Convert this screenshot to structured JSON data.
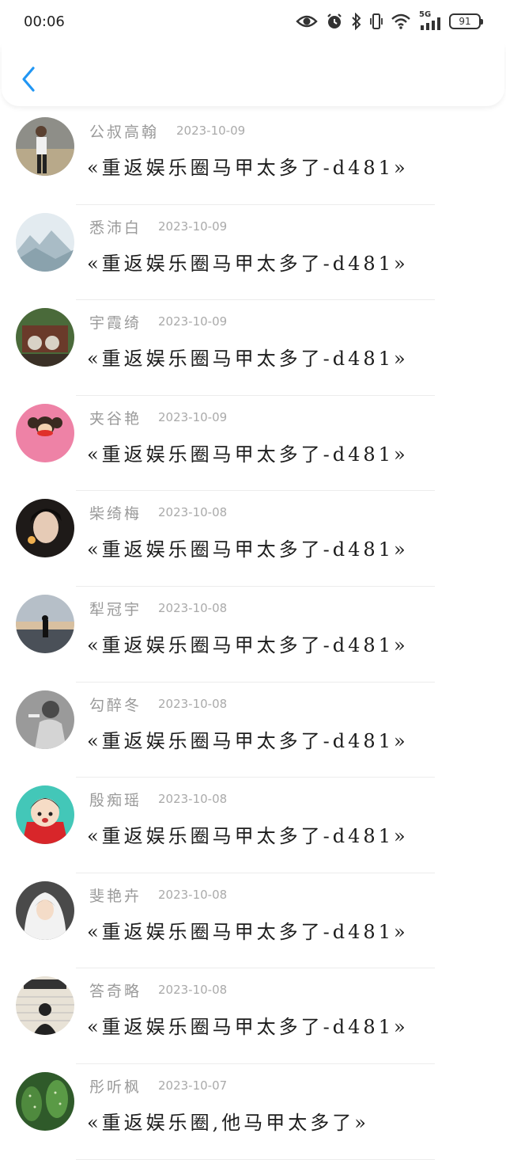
{
  "status": {
    "time": "00:06",
    "network": "5G",
    "battery": "91",
    "icons": [
      "eye-icon",
      "alarm-icon",
      "bluetooth-icon",
      "vibrate-icon",
      "wifi-icon",
      "signal-icon"
    ]
  },
  "header": {
    "back_icon": "chevron-left-icon"
  },
  "accent": "#2196F3",
  "items": [
    {
      "name": "公叔高翰",
      "date": "2023-10-09",
      "title": "«重返娱乐圈马甲太多了-d481»"
    },
    {
      "name": "悉沛白",
      "date": "2023-10-09",
      "title": "«重返娱乐圈马甲太多了-d481»"
    },
    {
      "name": "宇霞绮",
      "date": "2023-10-09",
      "title": "«重返娱乐圈马甲太多了-d481»"
    },
    {
      "name": "夹谷艳",
      "date": "2023-10-09",
      "title": "«重返娱乐圈马甲太多了-d481»"
    },
    {
      "name": "柴绮梅",
      "date": "2023-10-08",
      "title": "«重返娱乐圈马甲太多了-d481»"
    },
    {
      "name": "犁冠宇",
      "date": "2023-10-08",
      "title": "«重返娱乐圈马甲太多了-d481»"
    },
    {
      "name": "勾醉冬",
      "date": "2023-10-08",
      "title": "«重返娱乐圈马甲太多了-d481»"
    },
    {
      "name": "殷痴瑶",
      "date": "2023-10-08",
      "title": "«重返娱乐圈马甲太多了-d481»"
    },
    {
      "name": "斐艳卉",
      "date": "2023-10-08",
      "title": "«重返娱乐圈马甲太多了-d481»"
    },
    {
      "name": "答奇略",
      "date": "2023-10-08",
      "title": "«重返娱乐圈马甲太多了-d481»"
    },
    {
      "name": "彤听枫",
      "date": "2023-10-07",
      "title": "«重返娱乐圈,他马甲太多了»"
    }
  ]
}
